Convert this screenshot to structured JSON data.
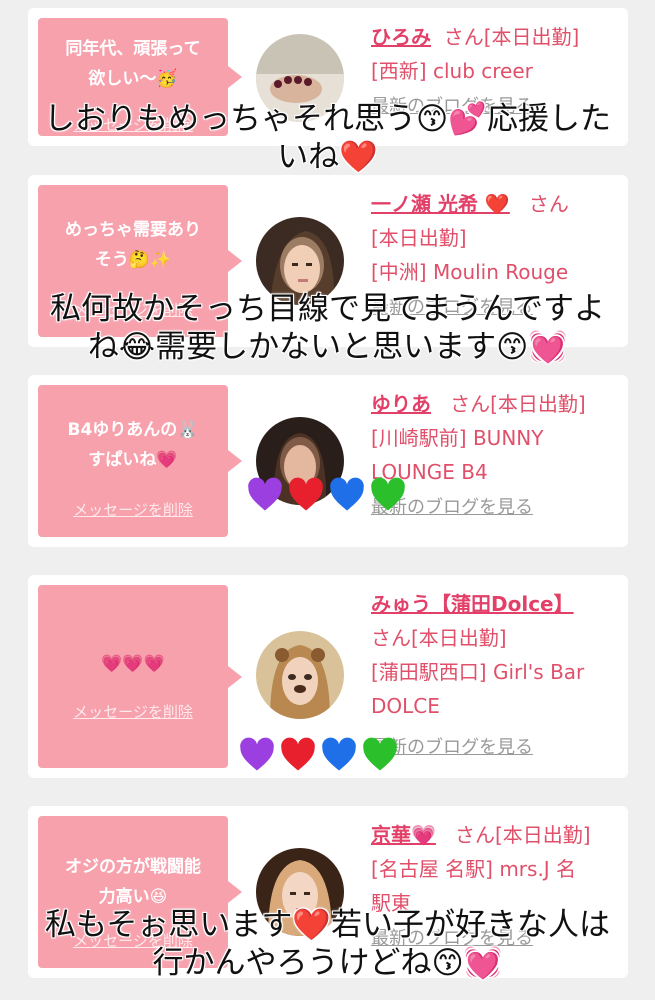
{
  "cards": [
    {
      "message": "同年代、頑張って欲しい〜🥳",
      "message_line1": "同年代、頑張って",
      "message_line2": "欲しい〜🥳",
      "delete_label": "メッセージを削除",
      "name": "ひろみ",
      "honorific": "さん",
      "status": "[本日出勤]",
      "shop_line1": "[西新] club creer",
      "blog_link": "最新のブログを見る"
    },
    {
      "message_line1": "めっちゃ需要あり",
      "message_line2": "そう🤔✨",
      "delete_label": "メッセージを削除",
      "name": "一ノ瀬 光希 ❤️",
      "honorific": "さん",
      "status": "[本日出勤]",
      "shop_line1": "[中洲] Moulin Rouge",
      "blog_link": "最新のブログを見る"
    },
    {
      "message_line1": "B4ゆりあんの🐰",
      "message_line2": "すぱいね💗",
      "delete_label": "メッセージを削除",
      "name": "ゆりあ",
      "honorific": "さん",
      "status": "[本日出勤]",
      "shop_line1": "[川崎駅前] BUNNY",
      "shop_line2": "LOUNGE B4",
      "blog_link": "最新のブログを見る"
    },
    {
      "message_line1": "💗💗💗",
      "delete_label": "メッセージを削除",
      "name": "みゅう【蒲田Dolce】",
      "honorific": "さん",
      "status": "[本日出勤]",
      "shop_line1": "[蒲田駅西口] Girl's Bar",
      "shop_line2": "DOLCE",
      "blog_link": "最新のブログを見る"
    },
    {
      "message_line1": "オジの方が戦闘能",
      "message_line2": "力高い😆",
      "delete_label": "メッセージを削除",
      "name": "京華💗",
      "honorific": "さん",
      "status": "[本日出勤]",
      "shop_line1": "[名古屋 名駅] mrs.J 名",
      "shop_line2": "駅東",
      "blog_link": "最新のブログを見る"
    }
  ],
  "overlays": [
    {
      "line1": "しおりもめっちゃそれ思う😙💕応援した",
      "line2": "いね❤️"
    },
    {
      "line1": "私何故かそっち目線で見てまうんですよ",
      "line2": "ね😂需要しかないと思います😙💓"
    },
    {
      "line1": "私もそぉ思います❤️若い子が好きな人は",
      "line2": "行かんやろうけどね😙💓"
    }
  ],
  "colors": {
    "purple": "#9b3fe0",
    "red": "#e8202e",
    "blue": "#1e6fe8",
    "green": "#2bc02b",
    "bubble": "#f7a1ad",
    "name": "#e24068"
  },
  "icons": [
    "purple-heart-icon",
    "red-heart-icon",
    "blue-heart-icon",
    "green-heart-icon"
  ]
}
